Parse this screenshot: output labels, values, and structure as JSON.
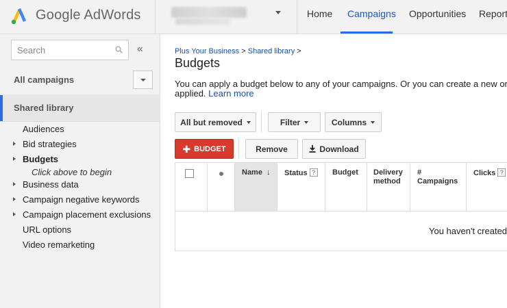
{
  "header": {
    "logo_text": "Google AdWords",
    "nav": [
      "Home",
      "Campaigns",
      "Opportunities",
      "Reports"
    ],
    "active_tab": "Campaigns"
  },
  "sidebar": {
    "search_placeholder": "Search",
    "collapse_icon": "«",
    "all_campaigns": "All campaigns",
    "shared_library": "Shared library",
    "items": [
      {
        "label": "Audiences",
        "expandable": false,
        "bold": false
      },
      {
        "label": "Bid strategies",
        "expandable": true,
        "bold": false
      },
      {
        "label": "Budgets",
        "expandable": true,
        "bold": true
      },
      {
        "label": "Business data",
        "expandable": true,
        "bold": false
      },
      {
        "label": "Campaign negative keywords",
        "expandable": true,
        "bold": false
      },
      {
        "label": "Campaign placement exclusions",
        "expandable": true,
        "bold": false
      },
      {
        "label": "URL options",
        "expandable": false,
        "bold": false
      },
      {
        "label": "Video remarketing",
        "expandable": false,
        "bold": false
      }
    ],
    "budgets_hint": "Click above to begin"
  },
  "main": {
    "breadcrumb": {
      "item1": "Plus Your Business",
      "sep": ">",
      "item2": "Shared library",
      "tail": ">"
    },
    "title": "Budgets",
    "desc_line1": "You can apply a budget below to any of your campaigns. Or you can create a new or",
    "desc_line2_prefix": "applied.",
    "learn_more": "Learn more",
    "toolbar": {
      "filter_status": "All but removed",
      "filter": "Filter",
      "columns": "Columns"
    },
    "actions": {
      "budget": "BUDGET",
      "remove": "Remove",
      "download": "Download"
    },
    "table": {
      "columns": [
        "Name",
        "Status",
        "Budget",
        "Delivery method",
        "# Campaigns",
        "Clicks"
      ],
      "help": "?",
      "empty": "You haven't created"
    }
  },
  "colors": {
    "accent_blue": "#2b6de0",
    "link_blue": "#1a4fa8",
    "budget_red": "#d73a2c"
  }
}
